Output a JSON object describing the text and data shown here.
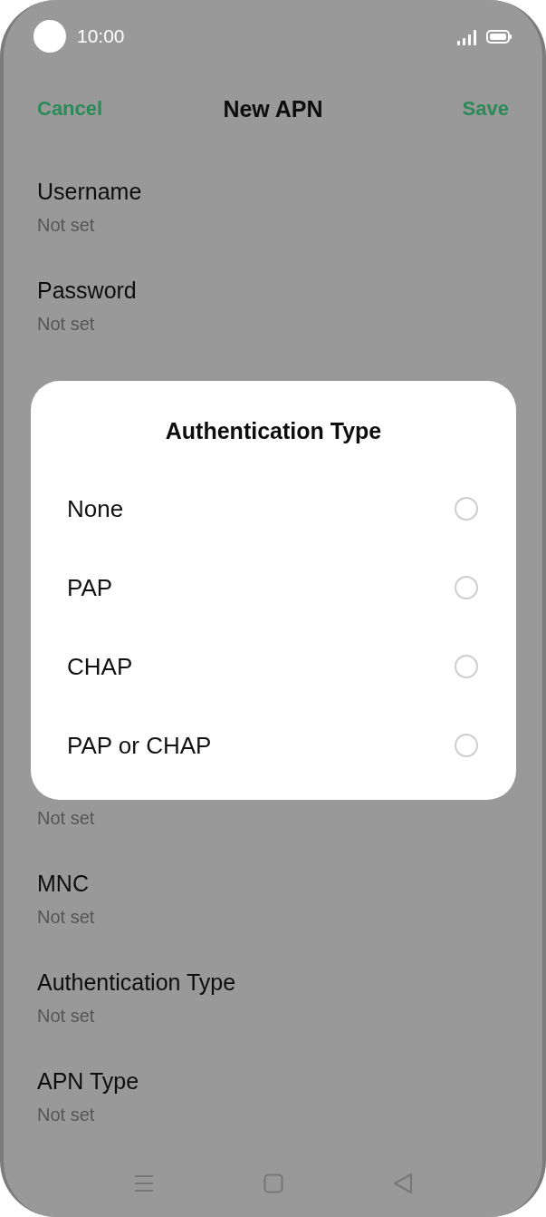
{
  "status_bar": {
    "time": "10:00"
  },
  "app_bar": {
    "cancel": "Cancel",
    "title": "New APN",
    "save": "Save"
  },
  "settings_top": [
    {
      "label": "Username",
      "value": "Not set"
    },
    {
      "label": "Password",
      "value": "Not set"
    }
  ],
  "settings_bottom": [
    {
      "value": "Not set"
    },
    {
      "label": "MNC",
      "value": "Not set"
    },
    {
      "label": "Authentication Type",
      "value": "Not set"
    },
    {
      "label": "APN Type",
      "value": "Not set"
    }
  ],
  "dialog": {
    "title": "Authentication Type",
    "options": [
      {
        "label": "None",
        "selected": false
      },
      {
        "label": "PAP",
        "selected": false
      },
      {
        "label": "CHAP",
        "selected": false
      },
      {
        "label": "PAP or CHAP",
        "selected": false
      }
    ]
  }
}
